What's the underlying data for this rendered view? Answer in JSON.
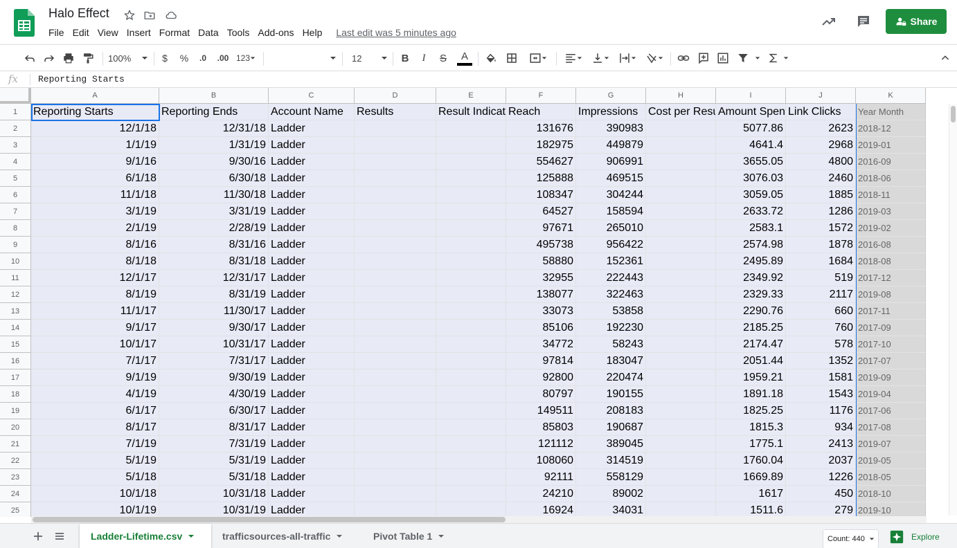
{
  "header": {
    "title": "Halo Effect",
    "menu": [
      "File",
      "Edit",
      "View",
      "Insert",
      "Format",
      "Data",
      "Tools",
      "Add-ons",
      "Help"
    ],
    "last_edit": "Last edit was 5 minutes ago",
    "share_label": "Share"
  },
  "toolbar": {
    "zoom": "100%",
    "currency": "$",
    "percent": "%",
    "decrease_decimal": ".0",
    "increase_decimal": ".00",
    "more_formats": "123",
    "font_size": "12",
    "bold": "B",
    "italic": "I",
    "strike": "S",
    "text_color": "A"
  },
  "formula_bar": {
    "fx": "fx",
    "content": "Reporting Starts"
  },
  "grid": {
    "columns": [
      "A",
      "B",
      "C",
      "D",
      "E",
      "F",
      "G",
      "H",
      "I",
      "J",
      "K"
    ],
    "row_numbers": [
      "1",
      "2",
      "3",
      "4",
      "5",
      "6",
      "7",
      "8",
      "9",
      "10",
      "11",
      "12",
      "13",
      "14",
      "15",
      "16",
      "17",
      "18",
      "19",
      "20",
      "21",
      "22",
      "23",
      "24",
      "25"
    ],
    "rows": [
      [
        "Reporting Starts",
        "Reporting Ends",
        "Account Name",
        "Results",
        "Result Indicator",
        "Reach",
        "Impressions",
        "Cost per Results",
        "Amount Spent",
        "Link Clicks",
        "Year Month"
      ],
      [
        "12/1/18",
        "12/31/18",
        "Ladder",
        "",
        "",
        "131676",
        "390983",
        "",
        "5077.86",
        "2623",
        "2018-12"
      ],
      [
        "1/1/19",
        "1/31/19",
        "Ladder",
        "",
        "",
        "182975",
        "449879",
        "",
        "4641.4",
        "2968",
        "2019-01"
      ],
      [
        "9/1/16",
        "9/30/16",
        "Ladder",
        "",
        "",
        "554627",
        "906991",
        "",
        "3655.05",
        "4800",
        "2016-09"
      ],
      [
        "6/1/18",
        "6/30/18",
        "Ladder",
        "",
        "",
        "125888",
        "469515",
        "",
        "3076.03",
        "2460",
        "2018-06"
      ],
      [
        "11/1/18",
        "11/30/18",
        "Ladder",
        "",
        "",
        "108347",
        "304244",
        "",
        "3059.05",
        "1885",
        "2018-11"
      ],
      [
        "3/1/19",
        "3/31/19",
        "Ladder",
        "",
        "",
        "64527",
        "158594",
        "",
        "2633.72",
        "1286",
        "2019-03"
      ],
      [
        "2/1/19",
        "2/28/19",
        "Ladder",
        "",
        "",
        "97671",
        "265010",
        "",
        "2583.1",
        "1572",
        "2019-02"
      ],
      [
        "8/1/16",
        "8/31/16",
        "Ladder",
        "",
        "",
        "495738",
        "956422",
        "",
        "2574.98",
        "1878",
        "2016-08"
      ],
      [
        "8/1/18",
        "8/31/18",
        "Ladder",
        "",
        "",
        "58880",
        "152361",
        "",
        "2495.89",
        "1684",
        "2018-08"
      ],
      [
        "12/1/17",
        "12/31/17",
        "Ladder",
        "",
        "",
        "32955",
        "222443",
        "",
        "2349.92",
        "519",
        "2017-12"
      ],
      [
        "8/1/19",
        "8/31/19",
        "Ladder",
        "",
        "",
        "138077",
        "322463",
        "",
        "2329.33",
        "2117",
        "2019-08"
      ],
      [
        "11/1/17",
        "11/30/17",
        "Ladder",
        "",
        "",
        "33073",
        "53858",
        "",
        "2290.76",
        "660",
        "2017-11"
      ],
      [
        "9/1/17",
        "9/30/17",
        "Ladder",
        "",
        "",
        "85106",
        "192230",
        "",
        "2185.25",
        "760",
        "2017-09"
      ],
      [
        "10/1/17",
        "10/31/17",
        "Ladder",
        "",
        "",
        "34772",
        "58243",
        "",
        "2174.47",
        "578",
        "2017-10"
      ],
      [
        "7/1/17",
        "7/31/17",
        "Ladder",
        "",
        "",
        "97814",
        "183047",
        "",
        "2051.44",
        "1352",
        "2017-07"
      ],
      [
        "9/1/19",
        "9/30/19",
        "Ladder",
        "",
        "",
        "92800",
        "220474",
        "",
        "1959.21",
        "1581",
        "2019-09"
      ],
      [
        "4/1/19",
        "4/30/19",
        "Ladder",
        "",
        "",
        "80797",
        "190155",
        "",
        "1891.18",
        "1543",
        "2019-04"
      ],
      [
        "6/1/17",
        "6/30/17",
        "Ladder",
        "",
        "",
        "149511",
        "208183",
        "",
        "1825.25",
        "1176",
        "2017-06"
      ],
      [
        "8/1/17",
        "8/31/17",
        "Ladder",
        "",
        "",
        "85803",
        "190687",
        "",
        "1815.3",
        "934",
        "2017-08"
      ],
      [
        "7/1/19",
        "7/31/19",
        "Ladder",
        "",
        "",
        "121112",
        "389045",
        "",
        "1775.1",
        "2413",
        "2019-07"
      ],
      [
        "5/1/19",
        "5/31/19",
        "Ladder",
        "",
        "",
        "108060",
        "314519",
        "",
        "1760.04",
        "2037",
        "2019-05"
      ],
      [
        "5/1/18",
        "5/31/18",
        "Ladder",
        "",
        "",
        "92111",
        "558129",
        "",
        "1669.89",
        "1226",
        "2018-05"
      ],
      [
        "10/1/18",
        "10/31/18",
        "Ladder",
        "",
        "",
        "24210",
        "89002",
        "",
        "1617",
        "450",
        "2018-10"
      ],
      [
        "10/1/19",
        "10/31/19",
        "Ladder",
        "",
        "",
        "16924",
        "34031",
        "",
        "1511.6",
        "279",
        "2019-10"
      ]
    ]
  },
  "sheets": {
    "tabs": [
      "Ladder-Lifetime.csv",
      "trafficsources-all-traffic",
      "Pivot Table 1"
    ],
    "active": 0,
    "count": "Count: 440",
    "explore": "Explore"
  },
  "colors": {
    "brand_green": "#1e8e3e",
    "selection_blue": "#1a73e8",
    "selected_fill": "#e8eaf6",
    "column_k_fill": "#d9d9d9"
  }
}
